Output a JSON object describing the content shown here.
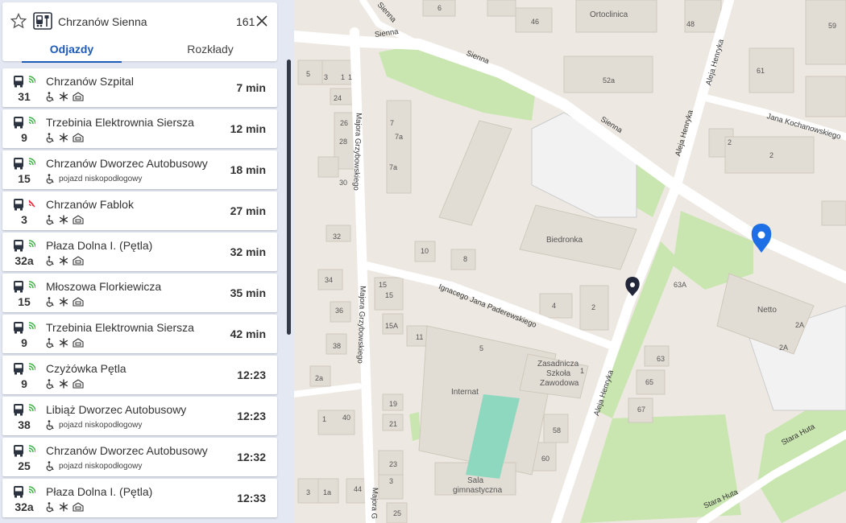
{
  "stop": {
    "name": "Chrzanów Sienna",
    "number": "161"
  },
  "tabs": {
    "departures": "Odjazdy",
    "schedules": "Rozkłady"
  },
  "departures": [
    {
      "line": "31",
      "destination": "Chrzanów Szpital",
      "time": "7 min",
      "features": [
        "wheelchair",
        "snow",
        "ac"
      ],
      "feature_text": "",
      "status": "live"
    },
    {
      "line": "9",
      "destination": "Trzebinia Elektrownia Siersza",
      "time": "12 min",
      "features": [
        "wheelchair",
        "snow",
        "ac"
      ],
      "feature_text": "",
      "status": "live"
    },
    {
      "line": "15",
      "destination": "Chrzanów Dworzec Autobusowy",
      "time": "18 min",
      "features": [
        "wheelchair"
      ],
      "feature_text": "pojazd niskopodłogowy",
      "status": "live"
    },
    {
      "line": "3",
      "destination": "Chrzanów Fablok",
      "time": "27 min",
      "features": [
        "wheelchair",
        "snow",
        "ac"
      ],
      "feature_text": "",
      "status": "offline"
    },
    {
      "line": "32a",
      "destination": "Płaza Dolna I. (Pętla)",
      "time": "32 min",
      "features": [
        "wheelchair",
        "snow",
        "ac"
      ],
      "feature_text": "",
      "status": "live"
    },
    {
      "line": "15",
      "destination": "Młoszowa Florkiewicza",
      "time": "35 min",
      "features": [
        "wheelchair",
        "snow",
        "ac"
      ],
      "feature_text": "",
      "status": "live"
    },
    {
      "line": "9",
      "destination": "Trzebinia Elektrownia Siersza",
      "time": "42 min",
      "features": [
        "wheelchair",
        "snow",
        "ac"
      ],
      "feature_text": "",
      "status": "live"
    },
    {
      "line": "9",
      "destination": "Czyżówka Pętla",
      "time": "12:23",
      "features": [
        "wheelchair",
        "snow",
        "ac"
      ],
      "feature_text": "",
      "status": "live"
    },
    {
      "line": "38",
      "destination": "Libiąż Dworzec Autobusowy",
      "time": "12:23",
      "features": [
        "wheelchair"
      ],
      "feature_text": "pojazd niskopodłogowy",
      "status": "live"
    },
    {
      "line": "25",
      "destination": "Chrzanów Dworzec Autobusowy",
      "time": "12:32",
      "features": [
        "wheelchair"
      ],
      "feature_text": "pojazd niskopodłogowy",
      "status": "live"
    },
    {
      "line": "32a",
      "destination": "Płaza Dolna I. (Pętla)",
      "time": "12:33",
      "features": [
        "wheelchair",
        "snow",
        "ac"
      ],
      "feature_text": "",
      "status": "live"
    }
  ],
  "map": {
    "streets": {
      "sienna_1": "Sienna",
      "sienna_2": "Sienna",
      "sienna_3": "Sienna",
      "majora_1": "Majora Grzybowskiego",
      "majora_2": "Majora Grzybowskiego",
      "majora_3": "Majora G",
      "aleja_1": "Aleja Henryka",
      "aleja_2": "Aleja Henryka",
      "aleja_3": "Aleja Henryka",
      "kochanowskiego": "Jana Kochanowskiego",
      "paderewskiego": "Ignacego Jana Paderewskiego",
      "stara_1": "Stara Huta",
      "stara_2": "Stara Huta"
    },
    "places": {
      "ortoclinica": "Ortoclinica",
      "biedronka": "Biedronka",
      "netto": "Netto",
      "internat": "Internat",
      "zasadnicza": "Zasadnicza",
      "szkola": "Szkoła",
      "zawodowa": "Zawodowa",
      "sala": "Sala",
      "gimnastyczna": "gimnastyczna"
    },
    "house_numbers": {
      "n6": "6",
      "n46": "46",
      "n48": "48",
      "n59": "59",
      "n5": "5",
      "n3": "3",
      "n1a": "1",
      "n1b": "1",
      "n24": "24",
      "n52a": "52a",
      "n61": "61",
      "n26": "26",
      "n7": "7",
      "n7a": "7a",
      "n7a2": "7a",
      "n28": "28",
      "n30": "30",
      "n2a": "2",
      "n2b": "2",
      "n32": "32",
      "n10": "10",
      "n8": "8",
      "n34": "34",
      "n15": "15",
      "n15b": "15",
      "n63a": "63A",
      "n4": "4",
      "n2c": "2",
      "n36": "36",
      "n15a": "15A",
      "n11": "11",
      "n38": "38",
      "n5b": "5",
      "n63": "63",
      "n2A1": "2A",
      "n2A2": "2A",
      "n2a_low": "2a",
      "n65": "65",
      "n1c": "1",
      "n67": "67",
      "n19": "19",
      "n40": "40",
      "n1d": "1",
      "n21": "21",
      "n58": "58",
      "n60": "60",
      "n23": "23",
      "n3b": "3",
      "n1a_low": "1a",
      "n44": "44",
      "n25": "25"
    }
  },
  "colors": {
    "accent": "#1c5bb8",
    "bus_icon": "#2b3240",
    "live_signal": "#3cb043",
    "offline_signal": "#e0293a",
    "map_bg": "#ede9e2",
    "park": "#c9e6b0",
    "panel_bg": "#e3e8f3"
  }
}
